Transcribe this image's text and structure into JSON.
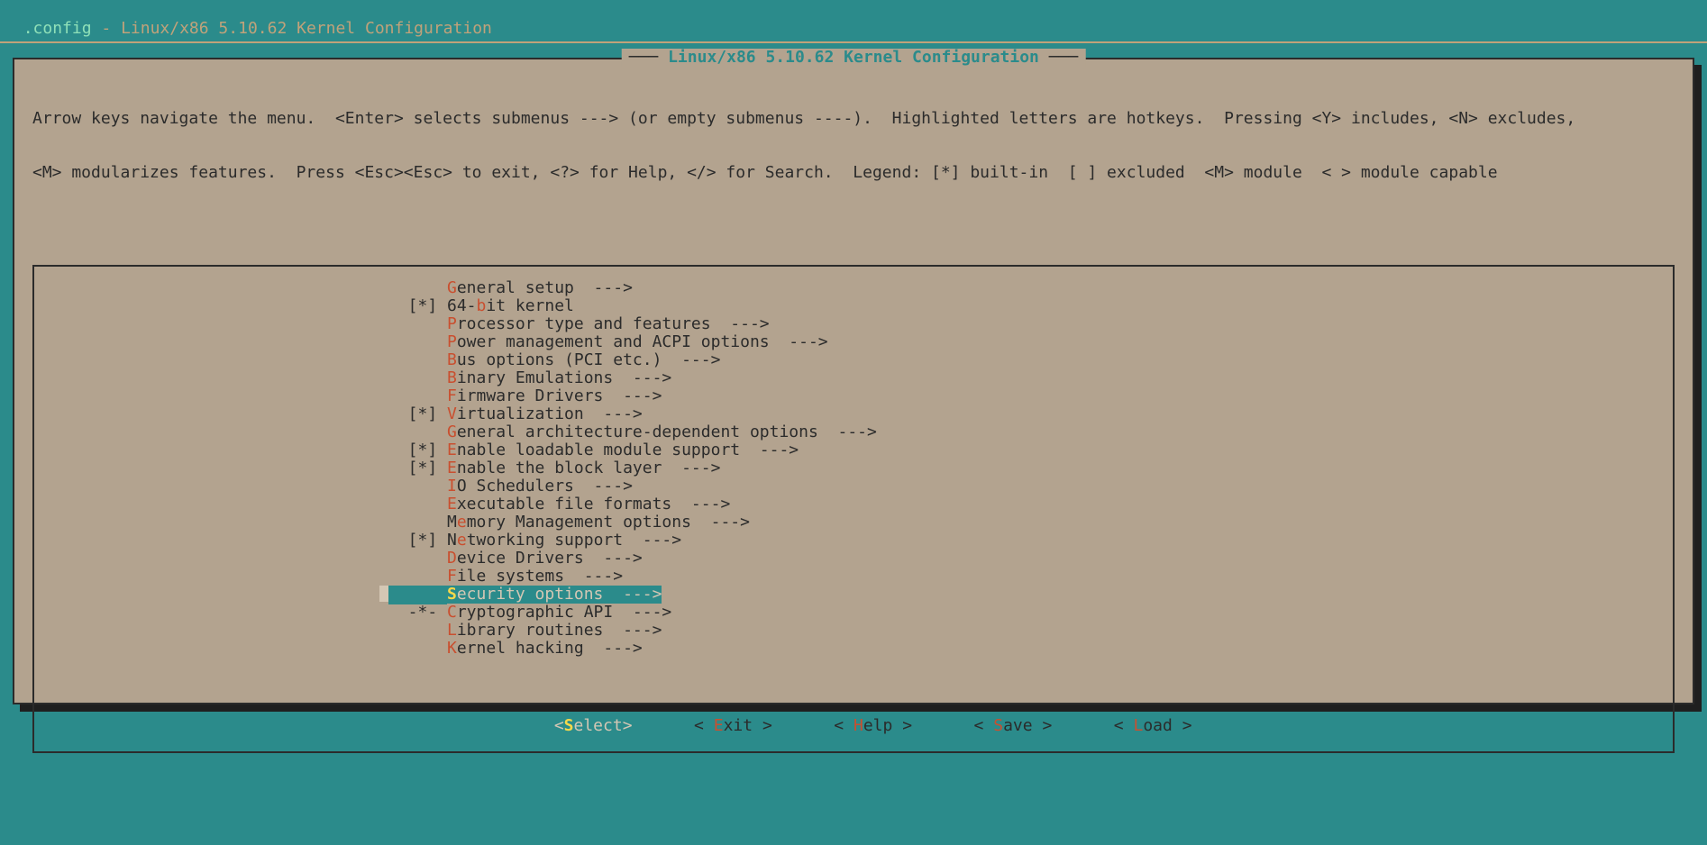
{
  "titlebar": {
    "file": ".config",
    "sep": " - ",
    "title": "Linux/x86 5.10.62 Kernel Configuration"
  },
  "panel_title": "Linux/x86 5.10.62 Kernel Configuration",
  "help_line1": "Arrow keys navigate the menu.  <Enter> selects submenus ---> (or empty submenus ----).  Highlighted letters are hotkeys.  Pressing <Y> includes, <N> excludes,",
  "help_line2": "<M> modularizes features.  Press <Esc><Esc> to exit, <?> for Help, </> for Search.  Legend: [*] built-in  [ ] excluded  <M> module  < > module capable",
  "menu": [
    {
      "check": "   ",
      "pre": "",
      "hot": "G",
      "rest": "eneral setup  --->",
      "selected": false
    },
    {
      "check": "[*]",
      "pre": "64-",
      "hot": "b",
      "rest": "it kernel",
      "selected": false
    },
    {
      "check": "   ",
      "pre": "",
      "hot": "P",
      "rest": "rocessor type and features  --->",
      "selected": false
    },
    {
      "check": "   ",
      "pre": "",
      "hot": "P",
      "rest": "ower management and ACPI options  --->",
      "selected": false
    },
    {
      "check": "   ",
      "pre": "",
      "hot": "B",
      "rest": "us options (PCI etc.)  --->",
      "selected": false
    },
    {
      "check": "   ",
      "pre": "",
      "hot": "B",
      "rest": "inary Emulations  --->",
      "selected": false
    },
    {
      "check": "   ",
      "pre": "",
      "hot": "F",
      "rest": "irmware Drivers  --->",
      "selected": false
    },
    {
      "check": "[*]",
      "pre": "",
      "hot": "V",
      "rest": "irtualization  --->",
      "selected": false
    },
    {
      "check": "   ",
      "pre": "",
      "hot": "G",
      "rest": "eneral architecture-dependent options  --->",
      "selected": false
    },
    {
      "check": "[*]",
      "pre": "",
      "hot": "E",
      "rest": "nable loadable module support  --->",
      "selected": false
    },
    {
      "check": "[*]",
      "pre": "",
      "hot": "E",
      "rest": "nable the block layer  --->",
      "selected": false
    },
    {
      "check": "   ",
      "pre": "",
      "hot": "I",
      "rest": "O Schedulers  --->",
      "selected": false
    },
    {
      "check": "   ",
      "pre": "",
      "hot": "E",
      "rest": "xecutable file formats  --->",
      "selected": false
    },
    {
      "check": "   ",
      "pre": "M",
      "hot": "e",
      "rest": "mory Management options  --->",
      "selected": false
    },
    {
      "check": "[*]",
      "pre": "N",
      "hot": "e",
      "rest": "tworking support  --->",
      "selected": false
    },
    {
      "check": "   ",
      "pre": "",
      "hot": "D",
      "rest": "evice Drivers  --->",
      "selected": false
    },
    {
      "check": "   ",
      "pre": "",
      "hot": "F",
      "rest": "ile systems  --->",
      "selected": false
    },
    {
      "check": "   ",
      "pre": "",
      "hot": "S",
      "rest": "ecurity options  --->",
      "selected": true
    },
    {
      "check": "-*-",
      "pre": "",
      "hot": "C",
      "rest": "ryptographic API  --->",
      "selected": false
    },
    {
      "check": "   ",
      "pre": "",
      "hot": "L",
      "rest": "ibrary routines  --->",
      "selected": false
    },
    {
      "check": "   ",
      "pre": "",
      "hot": "K",
      "rest": "ernel hacking  --->",
      "selected": false
    }
  ],
  "buttons": {
    "select": {
      "open": "<",
      "hot": "S",
      "rest": "elect",
      "close": ">"
    },
    "exit": {
      "open": "< ",
      "hot": "E",
      "rest": "xit ",
      "close": ">"
    },
    "help": {
      "open": "< ",
      "hot": "H",
      "rest": "elp ",
      "close": ">"
    },
    "save": {
      "open": "< ",
      "hot": "S",
      "rest": "ave ",
      "close": ">"
    },
    "load": {
      "open": "< ",
      "hot": "L",
      "rest": "oad ",
      "close": ">"
    }
  }
}
